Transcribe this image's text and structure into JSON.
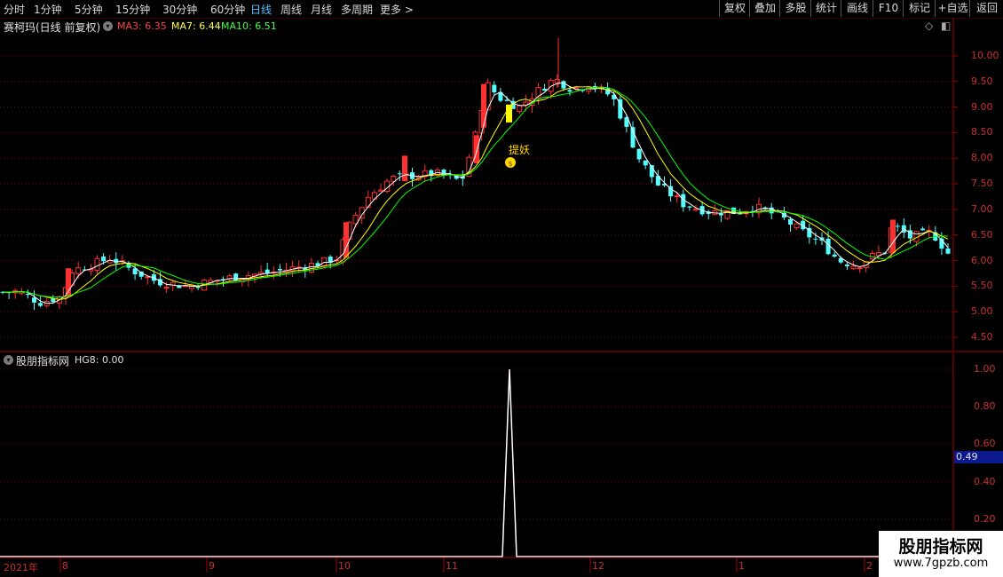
{
  "toolbar": {
    "periods": [
      "分时",
      "1分钟",
      "5分钟",
      "15分钟",
      "30分钟",
      "60分钟",
      "日线",
      "周线",
      "月线",
      "多周期",
      "更多 >"
    ],
    "right_buttons": [
      "复权",
      "叠加",
      "多股",
      "统计",
      "画线",
      "F10",
      "标记",
      "+自选",
      "返回"
    ]
  },
  "main_panel": {
    "title": "赛柯玛(日线 前复权)",
    "ma3": "MA3: 6.35",
    "ma7": "MA7: 6.44",
    "ma10": "MA10: 6.51",
    "price_ticks": [
      "10.00",
      "9.50",
      "9.00",
      "8.50",
      "8.00",
      "7.50",
      "7.00",
      "6.50",
      "6.00",
      "5.50",
      "5.00",
      "4.50"
    ],
    "marker_label": "提妖",
    "marker_icon": "money-bag-icon"
  },
  "sub_panel": {
    "title": "股朋指标网",
    "indicator": "HG8: 0.00",
    "ticks": [
      "1.00",
      "0.80",
      "0.60",
      "0.40",
      "0.20"
    ],
    "current_value": "0.49"
  },
  "time_axis": [
    "2021年",
    "8",
    "9",
    "10",
    "11",
    "12",
    "1",
    "2"
  ],
  "watermark": {
    "title": "股朋指标网",
    "url": "www.7gpzb.com"
  },
  "colors": {
    "up": "#ff3030",
    "down": "#54ffff",
    "ma3": "#ffffff",
    "ma7": "#ffff00",
    "ma10": "#00ff00",
    "grid": "#a00000"
  },
  "chart_data": {
    "type": "candlestick",
    "price_range": [
      4.3,
      10.35
    ],
    "sub_range": [
      0,
      1.05
    ],
    "ma3_last": 6.35,
    "ma7_last": 6.44,
    "ma10_last": 6.51,
    "hg8_spike_value": 1.0
  }
}
